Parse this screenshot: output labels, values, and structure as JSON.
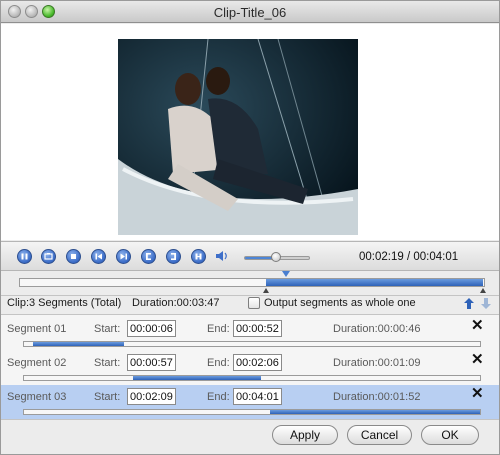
{
  "window": {
    "title": "Clip-Title_06"
  },
  "player": {
    "buttons": [
      "pause-icon",
      "snapshot-icon",
      "stop-icon",
      "previous-icon",
      "next-icon",
      "mark-in-icon",
      "mark-out-icon",
      "clip-icon"
    ],
    "volume_level": 0.49,
    "timecode": "00:02:19 / 00:04:01"
  },
  "timeline": {
    "selection_start_fraction": 0.53,
    "selection_end_fraction": 1.0,
    "playhead_fraction": 0.57
  },
  "clip_info": {
    "summary": "Clip:3 Segments (Total)",
    "duration": "Duration:00:03:47",
    "output_whole_label": "Output segments as whole one",
    "output_whole_checked": false
  },
  "segment_labels": {
    "start": "Start:",
    "end": "End:"
  },
  "segments": [
    {
      "name": "Segment 01",
      "start": "00:00:06",
      "end": "00:00:52",
      "duration": "Duration:00:00:46",
      "fill_from": 0.02,
      "fill_to": 0.22,
      "selected": false
    },
    {
      "name": "Segment 02",
      "start": "00:00:57",
      "end": "00:02:06",
      "duration": "Duration:00:01:09",
      "fill_from": 0.24,
      "fill_to": 0.52,
      "selected": false
    },
    {
      "name": "Segment 03",
      "start": "00:02:09",
      "end": "00:04:01",
      "duration": "Duration:00:01:52",
      "fill_from": 0.54,
      "fill_to": 1.0,
      "selected": true
    }
  ],
  "buttons": {
    "apply": "Apply",
    "cancel": "Cancel",
    "ok": "OK"
  },
  "colors": {
    "accent": "#3e6fc9",
    "selection": "#b8cff2"
  }
}
